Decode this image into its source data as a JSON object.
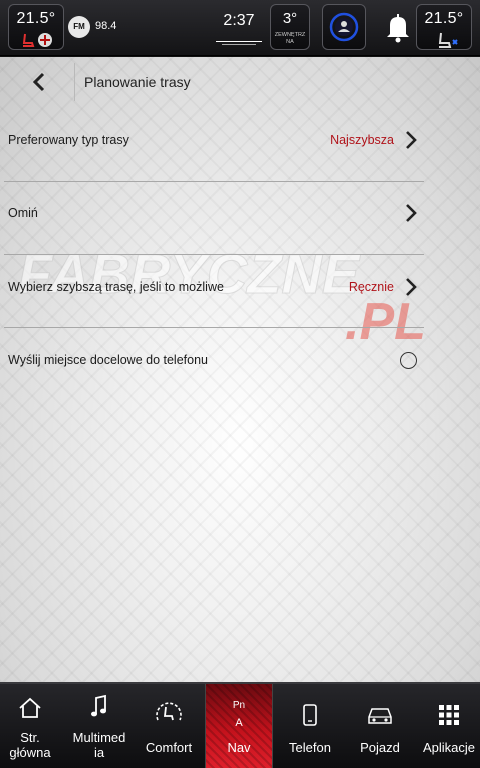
{
  "status_bar": {
    "temp_left": "21.5°",
    "temp_right": "21.5°",
    "radio_band": "FM",
    "radio_freq": "98.4",
    "clock": "2:37",
    "outside_temp": "3°",
    "outside_label_line1": "ZEWNĘTRZ",
    "outside_label_line2": "NA"
  },
  "header": {
    "title": "Planowanie trasy"
  },
  "settings": [
    {
      "label": "Preferowany typ trasy",
      "value": "Najszybsza",
      "control": "chevron"
    },
    {
      "label": "Omiń",
      "value": "",
      "control": "chevron"
    },
    {
      "label": "Wybierz szybszą trasę, jeśli to możliwe",
      "value": "Ręcznie",
      "control": "chevron"
    },
    {
      "label": "Wyślij miejsce docelowe do telefonu",
      "value": "",
      "control": "radio",
      "checked": false
    }
  ],
  "watermark": {
    "line1": "FABRYCZNE",
    "line2": ".PL"
  },
  "bottom_nav": {
    "home": "Str. główna",
    "home_l1": "Str.",
    "home_l2": "główna",
    "media_l1": "Multimed",
    "media_l2": "ia",
    "comfort": "Comfort",
    "nav": "Nav",
    "gear_pn": "Pn",
    "gear_a": "A",
    "phone": "Telefon",
    "vehicle": "Pojazd",
    "apps": "Aplikacje"
  },
  "colors": {
    "accent_red": "#b0131a",
    "nav_active": "#c4121c"
  }
}
